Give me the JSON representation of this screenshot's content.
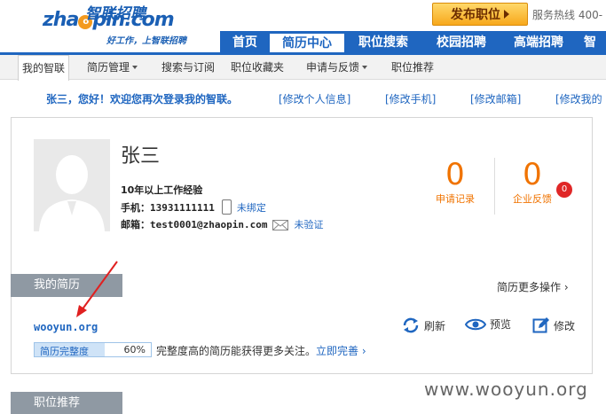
{
  "header": {
    "logo_brand": "zhaopin.com",
    "logo_cn": "智联招聘",
    "slogan": "好工作，上智联招聘",
    "post_job_label": "发布职位",
    "hotline": "服务热线  400-"
  },
  "main_nav": [
    {
      "label": "首页",
      "active": false
    },
    {
      "label": "简历中心",
      "active": true
    },
    {
      "label": "职位搜索",
      "active": false
    },
    {
      "label": "校园招聘",
      "active": false
    },
    {
      "label": "高端招聘",
      "active": false
    },
    {
      "label": "智",
      "active": false
    }
  ],
  "sub_nav": [
    {
      "label": "我的智联",
      "active": true
    },
    {
      "label": "简历管理",
      "dropdown": true
    },
    {
      "label": "搜索与订阅"
    },
    {
      "label": "职位收藏夹"
    },
    {
      "label": "申请与反馈",
      "dropdown": true
    },
    {
      "label": "职位推荐"
    }
  ],
  "welcome": {
    "text": "张三，您好！欢迎您再次登录我的智联。",
    "links": [
      "[修改个人信息]",
      "[修改手机]",
      "[修改邮箱]",
      "[修改我的"
    ]
  },
  "profile": {
    "name": "张三",
    "experience": "10年以上工作经验",
    "phone_label": "手机：",
    "phone": "13931111111",
    "phone_status": "未绑定",
    "email_label": "邮箱：",
    "email": "test0001@zhaopin.com",
    "email_status": "未验证"
  },
  "stats": {
    "applications_count": "0",
    "applications_label": "申请记录",
    "feedback_count": "0",
    "feedback_label": "企业反馈",
    "feedback_badge": "0"
  },
  "resume_section": {
    "title": "我的简历",
    "more_ops": "简历更多操作",
    "resume_name": "wooyun.org",
    "actions": {
      "refresh": "刷新",
      "preview": "预览",
      "edit": "修改"
    },
    "completeness_label": "简历完整度",
    "completeness_value": "60%",
    "completeness_fraction": 0.6,
    "tip": "完整度高的简历能获得更多关注。",
    "improve_link": "立即完善"
  },
  "recommend_section": {
    "title": "职位推荐"
  },
  "watermark": "www.wooyun.org",
  "colors": {
    "brand_blue": "#1f66c0",
    "accent_orange": "#f07300",
    "badge_red": "#e02727",
    "arrow_red": "#e02020"
  }
}
